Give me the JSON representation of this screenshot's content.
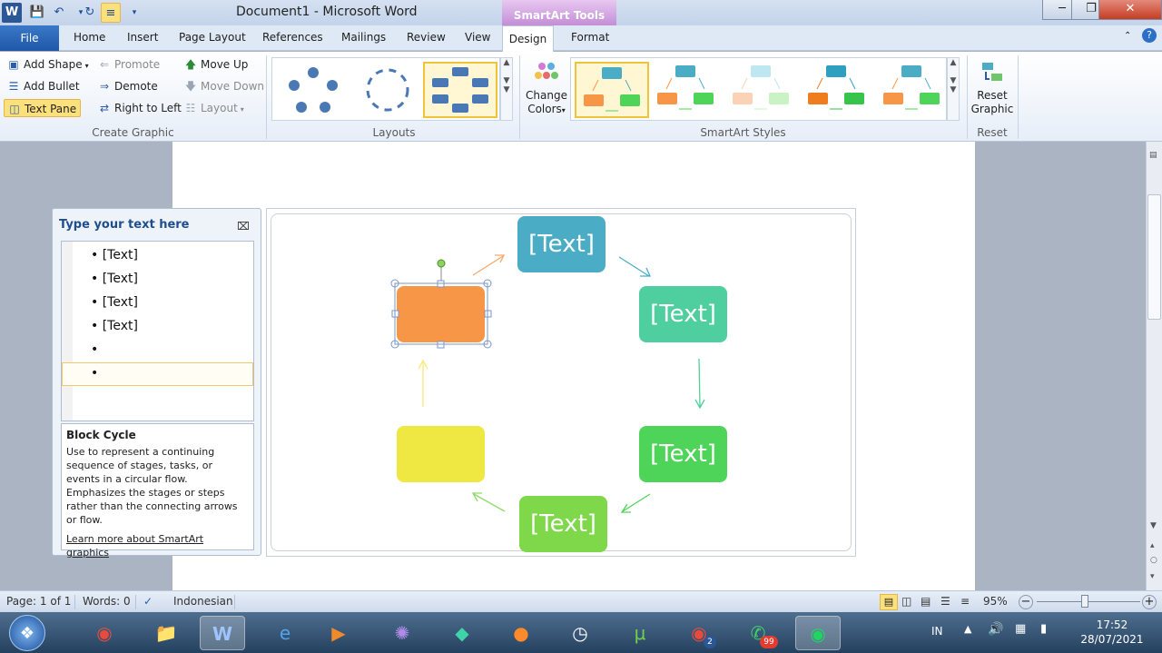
{
  "app": {
    "title": "Document1  -  Microsoft Word",
    "contextual_tab_group": "SmartArt Tools",
    "word_icon": "W"
  },
  "tabs": {
    "file": "File",
    "home": "Home",
    "insert": "Insert",
    "page_layout": "Page Layout",
    "references": "References",
    "mailings": "Mailings",
    "review": "Review",
    "view": "View",
    "design": "Design",
    "format": "Format"
  },
  "ribbon": {
    "create_graphic": {
      "label": "Create Graphic",
      "add_shape": "Add Shape",
      "add_bullet": "Add Bullet",
      "text_pane": "Text Pane",
      "promote": "Promote",
      "demote": "Demote",
      "right_to_left": "Right to Left",
      "move_up": "Move Up",
      "move_down": "Move Down",
      "layout": "Layout"
    },
    "layouts": {
      "label": "Layouts"
    },
    "smartart_styles": {
      "label": "SmartArt Styles",
      "change_colors_1": "Change",
      "change_colors_2": "Colors"
    },
    "reset": {
      "label": "Reset",
      "reset_graphic_1": "Reset",
      "reset_graphic_2": "Graphic"
    }
  },
  "text_pane": {
    "title": "Type your text here",
    "items": [
      "[Text]",
      "[Text]",
      "[Text]",
      "[Text]",
      "",
      ""
    ],
    "description_title": "Block Cycle",
    "description": "Use to represent a continuing sequence of stages, tasks, or events in a circular flow. Emphasizes the stages or steps rather than the connecting arrows or flow.",
    "learn_more": "Learn more about SmartArt graphics"
  },
  "smartart": {
    "nodes": [
      {
        "text": "[Text]",
        "color": "#4bacc6"
      },
      {
        "text": "[Text]",
        "color": "#4fcf9f"
      },
      {
        "text": "[Text]",
        "color": "#4fd45a"
      },
      {
        "text": "[Text]",
        "color": "#7ed84a"
      },
      {
        "text": "",
        "color": "#efe842"
      },
      {
        "text": "",
        "color": "#f79646"
      }
    ]
  },
  "status": {
    "page": "Page: 1 of 1",
    "words": "Words: 0",
    "language": "Indonesian",
    "zoom": "95%"
  },
  "taskbar": {
    "lang": "IN",
    "time": "17:52",
    "date": "28/07/2021",
    "whatsapp_badge": "99",
    "chrome_badge": "2"
  },
  "colors": {
    "accent_blue": "#1e58a8",
    "selection_yellow": "#fce07c"
  }
}
